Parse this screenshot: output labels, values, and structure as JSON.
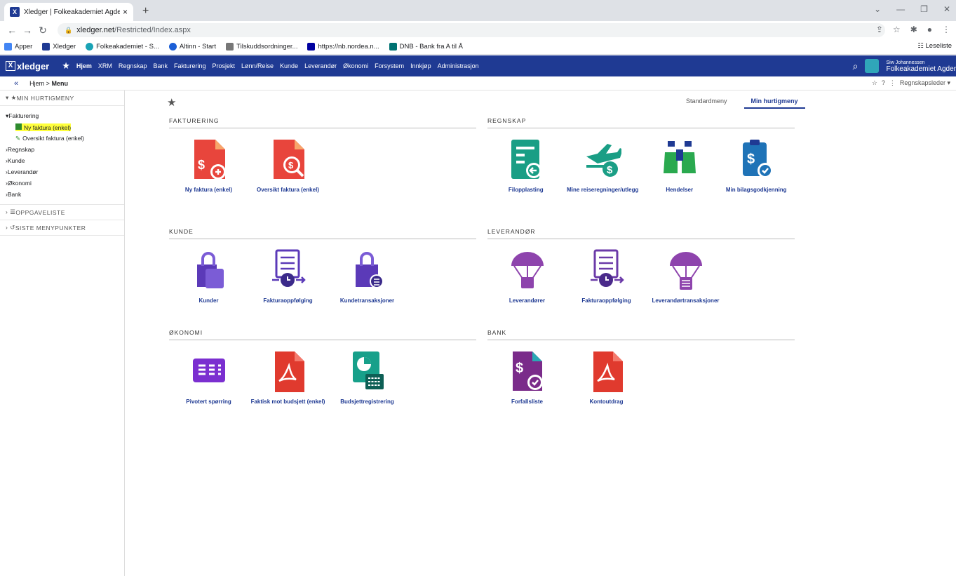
{
  "browser": {
    "tab_title": "Xledger | Folkeakademiet Agder",
    "url_host": "xledger.net",
    "url_path": "/Restricted/Index.aspx",
    "bookmarks": [
      "Apper",
      "Xledger",
      "Folkeakademiet - S...",
      "Altinn - Start",
      "Tilskuddsordninger...",
      "https://nb.nordea.n...",
      "DNB - Bank fra A til Å"
    ],
    "reading_list": "Leseliste"
  },
  "appbar": {
    "logo": "xledger",
    "nav": [
      "Hjem",
      "XRM",
      "Regnskap",
      "Bank",
      "Fakturering",
      "Prosjekt",
      "Lønn/Reise",
      "Kunde",
      "Leverandør",
      "Økonomi",
      "Forsystem",
      "Innkjøp",
      "Administrasjon"
    ],
    "user_name": "Siw Johannessen",
    "company": "Folkeakademiet Agder"
  },
  "breadcrumb": {
    "home": "Hjem",
    "sep": ">",
    "current": "Menu",
    "role": "Regnskapsleder"
  },
  "sidebar": {
    "quickmenu": "MIN HURTIGMENY",
    "group": "Fakturering",
    "items": [
      "Ny faktura (enkel)",
      "Oversikt faktura (enkel)"
    ],
    "folders": [
      "Regnskap",
      "Kunde",
      "Leverandør",
      "Økonomi",
      "Bank"
    ],
    "tasks": "OPPGAVELISTE",
    "recent": "SISTE MENYPUNKTER"
  },
  "tabs": {
    "standard": "Standardmeny",
    "mine": "Min hurtigmeny"
  },
  "groups": [
    {
      "title": "FAKTURERING",
      "items": [
        "Ny faktura (enkel)",
        "Oversikt faktura (enkel)"
      ]
    },
    {
      "title": "REGNSKAP",
      "items": [
        "Filopplasting",
        "Mine reiseregninger/utlegg",
        "Hendelser",
        "Min bilagsgodkjenning"
      ]
    },
    {
      "title": "KUNDE",
      "items": [
        "Kunder",
        "Fakturaoppfølging",
        "Kundetransaksjoner"
      ]
    },
    {
      "title": "LEVERANDØR",
      "items": [
        "Leverandører",
        "Fakturaoppfølging",
        "Leverandørtransaksjoner"
      ]
    },
    {
      "title": "ØKONOMI",
      "items": [
        "Pivotert spørring",
        "Faktisk mot budsjett (enkel)",
        "Budsjettregistrering"
      ]
    },
    {
      "title": "BANK",
      "items": [
        "Forfallsliste",
        "Kontoutdrag"
      ]
    }
  ],
  "colors": {
    "brand": "#1f3a93",
    "highlight": "#ffff3c"
  }
}
